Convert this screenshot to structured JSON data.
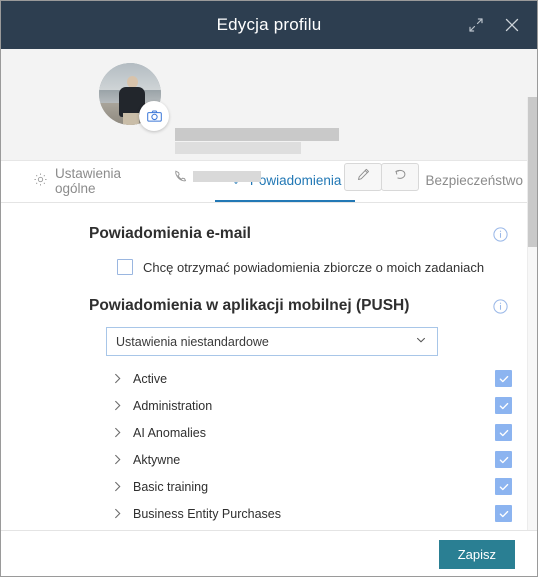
{
  "window": {
    "title": "Edycja profilu",
    "titlebar_bg": "#2d3e50",
    "accent_blue": "#2278b5",
    "save_teal": "#2a7f93",
    "checkbox_blue": "#8cb4f0",
    "expand_icon": "expand-icon",
    "close_icon": "close-icon"
  },
  "profile": {
    "avatar_alt": "user-avatar-photo",
    "camera_badge_icon": "camera-icon",
    "name_redacted": "",
    "phone_icon": "phone-icon",
    "phone_redacted": "",
    "edit_icon": "pencil-icon",
    "undo_icon": "undo-icon"
  },
  "tabs": [
    {
      "label": "Ustawienia ogólne",
      "icon": "gear-icon",
      "active": false
    },
    {
      "label": "Powiadomienia",
      "icon": "bell-icon",
      "active": true
    },
    {
      "label": "Bezpieczeństwo",
      "icon": "lock-icon",
      "active": false
    }
  ],
  "email_section": {
    "title": "Powiadomienia e-mail",
    "info_icon": "info-icon",
    "checkbox_label": "Chcę otrzymać powiadomienia zbiorcze o moich zadaniach",
    "checkbox_checked": false
  },
  "push_section": {
    "title": "Powiadomienia w aplikacji mobilnej (PUSH)",
    "info_icon": "info-icon",
    "select_value": "Ustawienia niestandardowe",
    "select_chevron": "chevron-down-icon",
    "items": [
      {
        "label": "Active",
        "checked": true
      },
      {
        "label": "Administration",
        "checked": true
      },
      {
        "label": "AI Anomalies",
        "checked": true
      },
      {
        "label": "Aktywne",
        "checked": true
      },
      {
        "label": "Basic training",
        "checked": true
      },
      {
        "label": "Business Entity Purchases",
        "checked": true
      }
    ]
  },
  "footer": {
    "save_label": "Zapisz"
  }
}
